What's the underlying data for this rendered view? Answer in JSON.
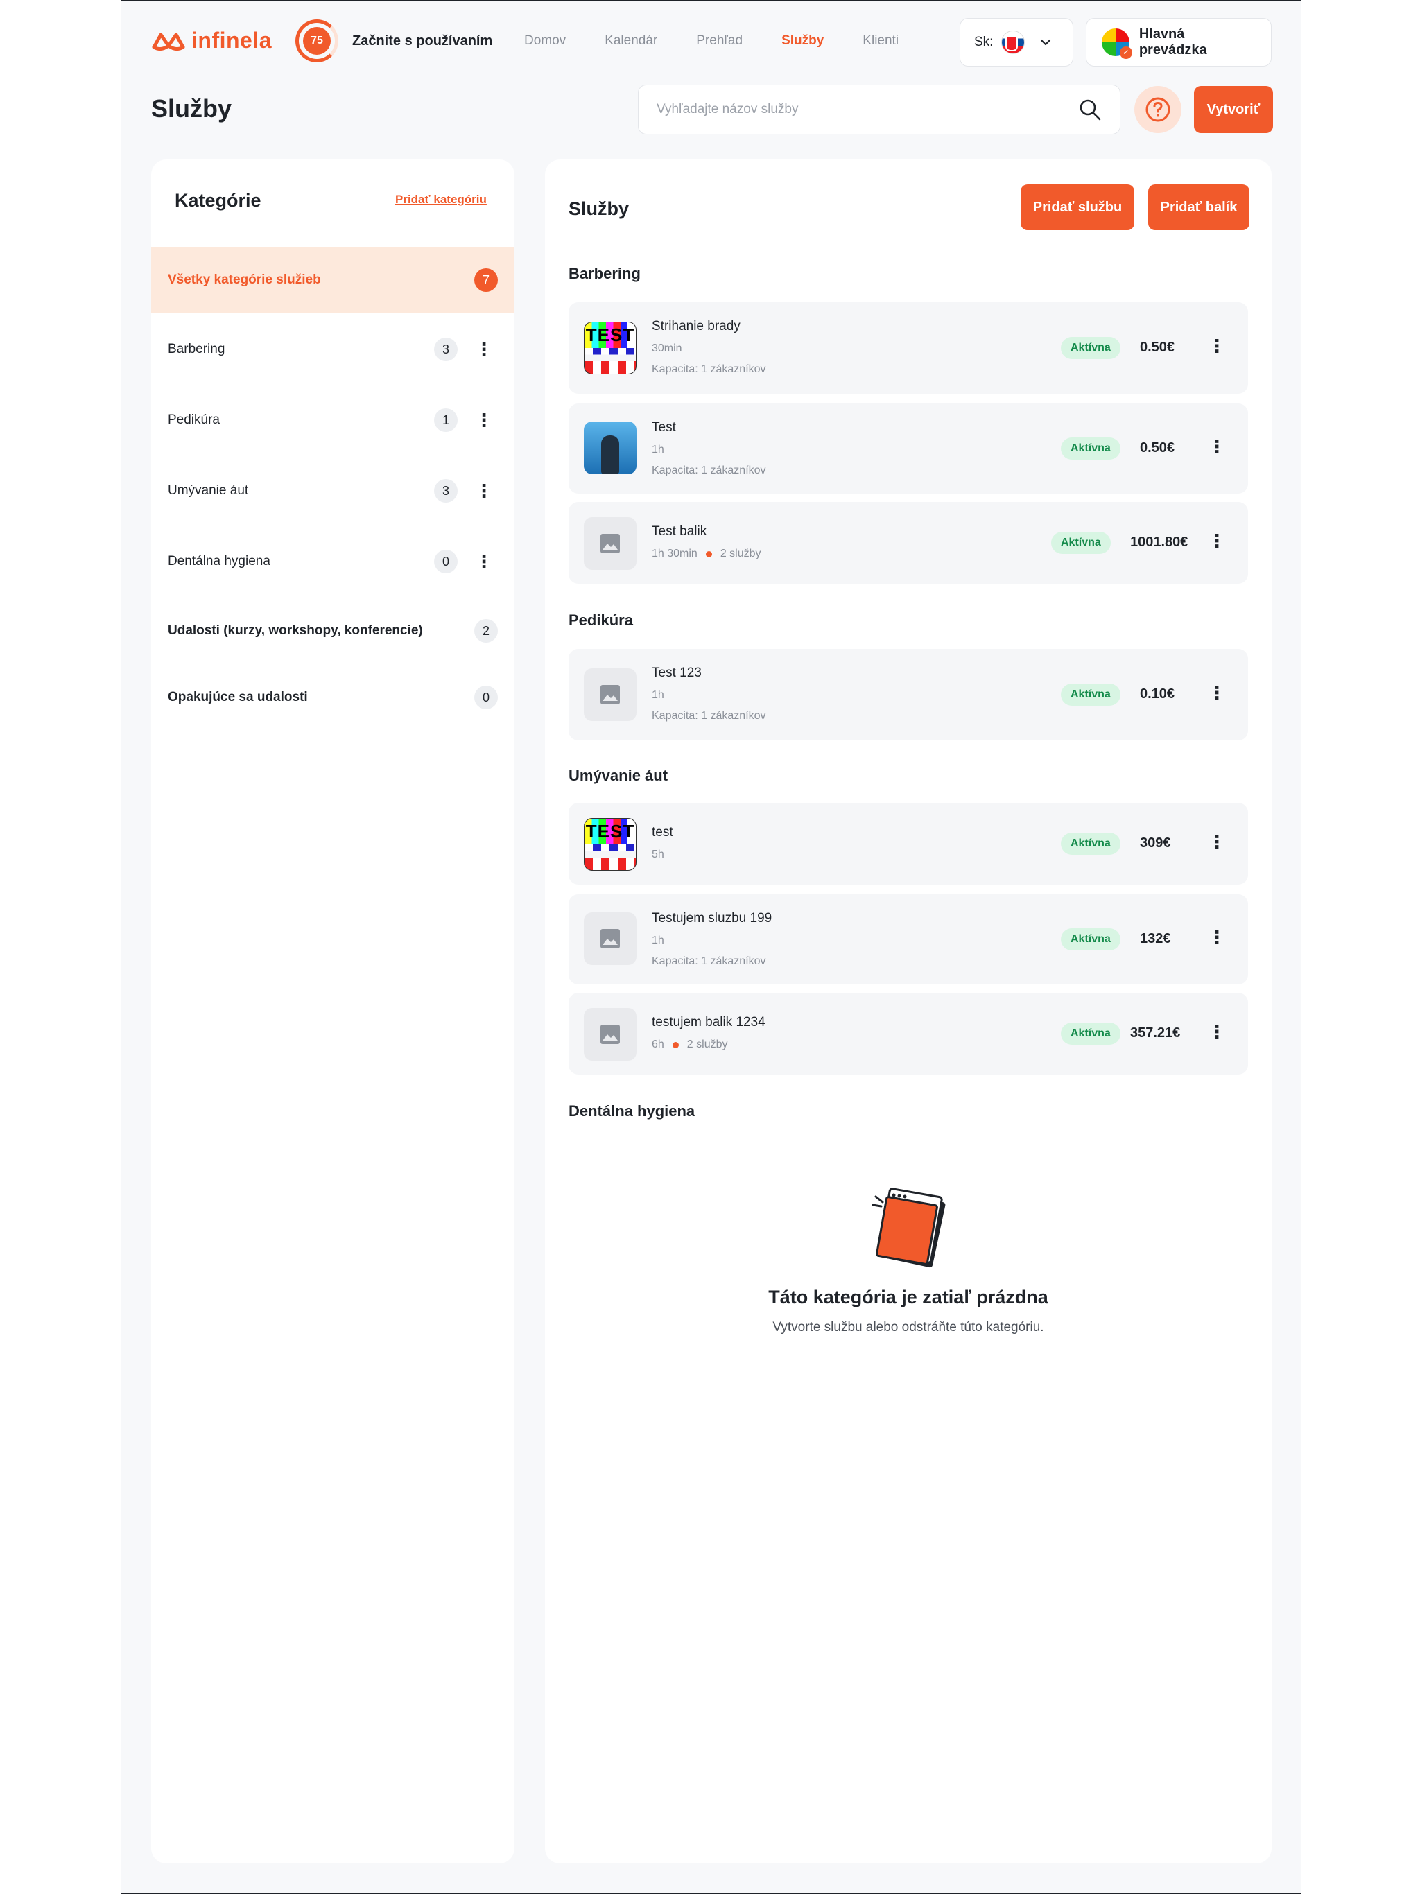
{
  "header": {
    "logo_text": "infinela",
    "progress_value": "75",
    "progress_label": "Začnite s používaním",
    "nav": [
      "Domov",
      "Kalendár",
      "Prehľad",
      "Služby",
      "Klienti"
    ],
    "active_nav": "Služby",
    "lang_label": "Sk:",
    "branch_name": "Hlavná prevádzka"
  },
  "page": {
    "title": "Služby",
    "search_placeholder": "Vyhľadajte názov služby",
    "create_label": "Vytvoriť"
  },
  "categories": {
    "title": "Kategórie",
    "add_label": "Pridať kategóriu",
    "items": [
      {
        "name": "Všetky kategórie služieb",
        "count": "7"
      },
      {
        "name": "Barbering",
        "count": "3"
      },
      {
        "name": "Pedikúra",
        "count": "1"
      },
      {
        "name": "Umývanie áut",
        "count": "3"
      },
      {
        "name": "Dentálna hygiena",
        "count": "0"
      },
      {
        "name": "Udalosti (kurzy, workshopy, konferencie)",
        "count": "2"
      },
      {
        "name": "Opakujúce sa udalosti",
        "count": "0"
      }
    ]
  },
  "services": {
    "title": "Služby",
    "add_service_label": "Pridať službu",
    "add_package_label": "Pridať balík",
    "status_label": "Aktívna",
    "groups": [
      {
        "title": "Barbering",
        "items": [
          {
            "name": "Strihanie brady",
            "duration": "30min",
            "capacity": "Kapacita: 1 zákazníkov",
            "price": "0.50€",
            "thumb_text": "TEST"
          },
          {
            "name": "Test",
            "duration": "1h",
            "capacity": "Kapacita: 1 zákazníkov",
            "price": "0.50€"
          },
          {
            "name": "Test balik",
            "duration": "1h 30min",
            "services_count": "2 služby",
            "price": "1001.80€"
          }
        ]
      },
      {
        "title": "Pedikúra",
        "items": [
          {
            "name": "Test 123",
            "duration": "1h",
            "capacity": "Kapacita: 1 zákazníkov",
            "price": "0.10€"
          }
        ]
      },
      {
        "title": "Umývanie áut",
        "items": [
          {
            "name": "test",
            "duration": "5h",
            "price": "309€",
            "thumb_text": "TEST"
          },
          {
            "name": "Testujem sluzbu 199",
            "duration": "1h",
            "capacity": "Kapacita: 1 zákazníkov",
            "price": "132€"
          },
          {
            "name": "testujem balik 1234",
            "duration": "6h",
            "services_count": "2 služby",
            "price": "357.21€"
          }
        ]
      },
      {
        "title": "Dentálna hygiena",
        "items": []
      }
    ],
    "empty_title": "Táto kategória je zatiaľ prázdna",
    "empty_subtitle": "Vytvorte službu alebo odstráňte túto kategóriu."
  },
  "colors": {
    "accent": "#f15a2b",
    "accent_light": "#fde9dc",
    "active_badge_bg": "#d8f5e3",
    "active_badge_text": "#138a4a"
  }
}
